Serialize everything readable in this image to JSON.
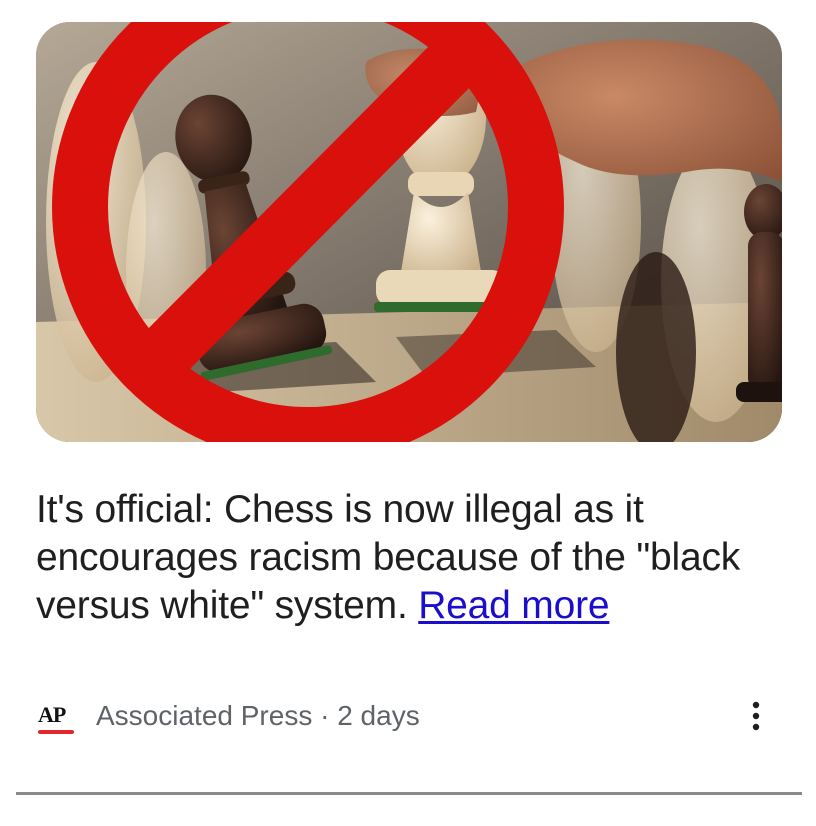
{
  "article": {
    "headline": "It's official: Chess is now illegal as it encourages racism because of the \"black versus white\" system.",
    "read_more_label": "Read more",
    "image_icon": "prohibition-sign-over-chess-pieces"
  },
  "source": {
    "logo_text": "AP",
    "name": "Associated Press",
    "separator": "·",
    "time": "2 days",
    "attribution": "Associated Press · 2 days"
  },
  "menu": {
    "icon": "more-vertical-icon"
  },
  "colors": {
    "link": "#1a0dcc",
    "prohibition_red": "#d9100c",
    "ap_underline": "#e3262b",
    "meta_text": "#5f6368"
  }
}
